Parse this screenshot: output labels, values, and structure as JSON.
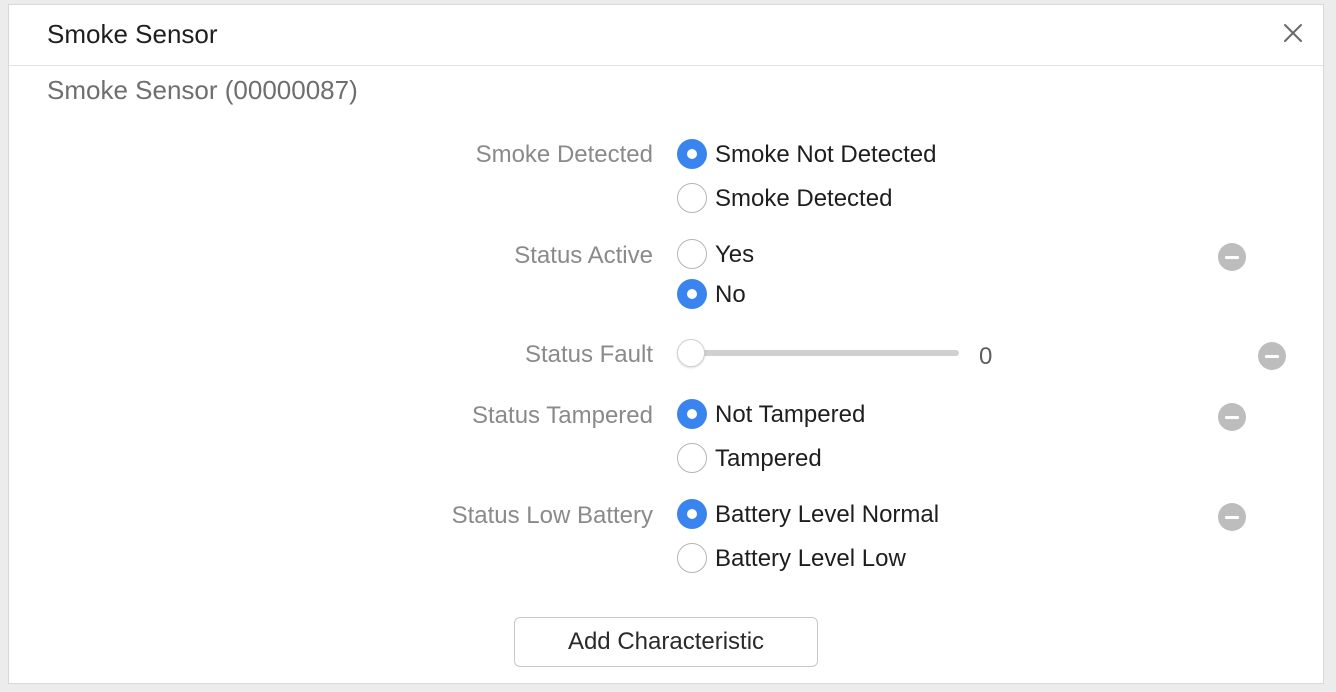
{
  "window": {
    "title": "Smoke Sensor",
    "subtitle": "Smoke Sensor (00000087)"
  },
  "characteristics": {
    "smoke_detected": {
      "label": "Smoke Detected",
      "options": [
        "Smoke Not Detected",
        "Smoke Detected"
      ],
      "selected": "Smoke Not Detected"
    },
    "status_active": {
      "label": "Status Active",
      "options": [
        "Yes",
        "No"
      ],
      "selected": "No"
    },
    "status_fault": {
      "label": "Status Fault",
      "value": "0",
      "slider_fraction": 0
    },
    "status_tampered": {
      "label": "Status Tampered",
      "options": [
        "Not Tampered",
        "Tampered"
      ],
      "selected": "Not Tampered"
    },
    "status_low_battery": {
      "label": "Status Low Battery",
      "options": [
        "Battery Level Normal",
        "Battery Level Low"
      ],
      "selected": "Battery Level Normal"
    }
  },
  "actions": {
    "add_characteristic": "Add Characteristic"
  },
  "colors": {
    "accent": "#3a84f0",
    "remove_button": "#bdbdbd"
  },
  "icons": {
    "close": "close-icon",
    "remove": "minus-circle-icon"
  }
}
